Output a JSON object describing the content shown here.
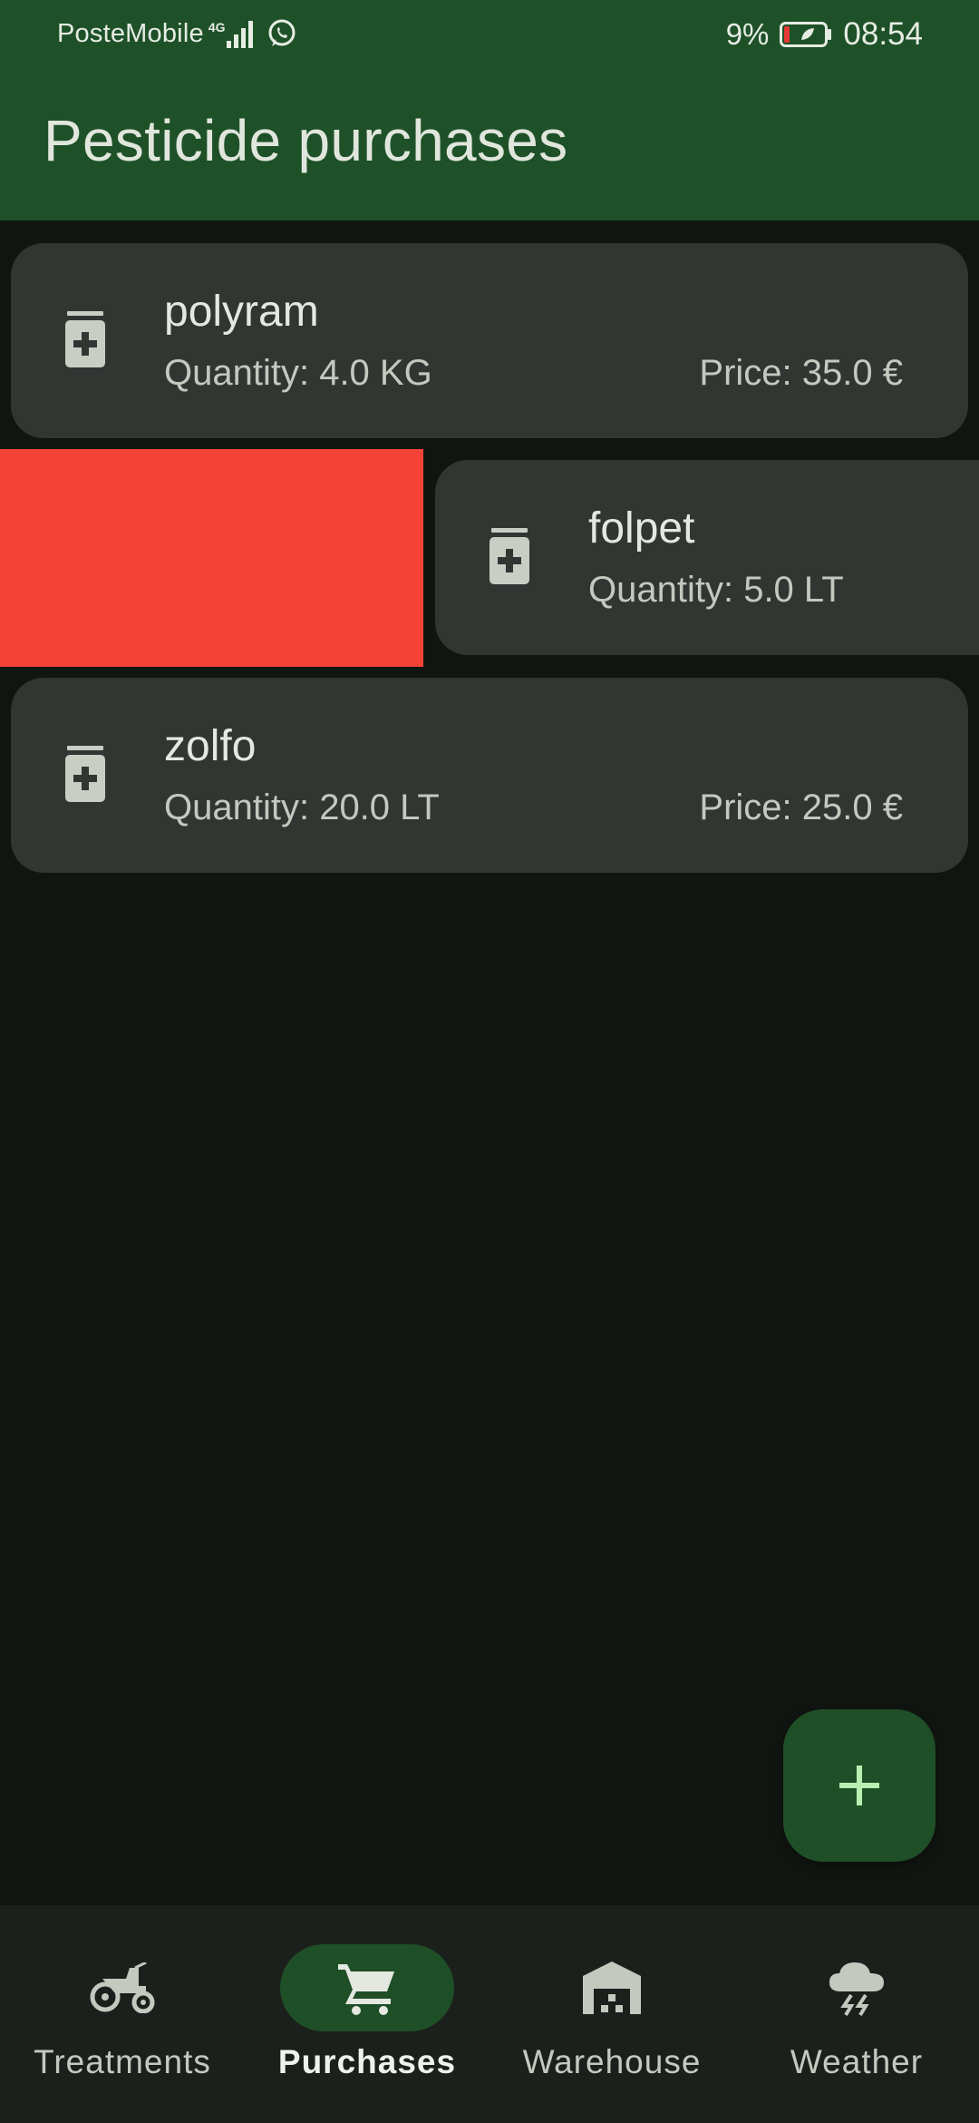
{
  "status_bar": {
    "carrier": "PosteMobile",
    "network": "4G",
    "battery_percent": "9%",
    "time": "08:54"
  },
  "app_bar": {
    "title": "Pesticide purchases"
  },
  "purchases": [
    {
      "name": "polyram",
      "quantity": "Quantity: 4.0 KG",
      "price": "Price: 35.0 €"
    },
    {
      "name": "folpet",
      "quantity": "Quantity: 5.0 LT",
      "price": ""
    },
    {
      "name": "zolfo",
      "quantity": "Quantity: 20.0 LT",
      "price": "Price: 25.0 €"
    }
  ],
  "fab": {
    "icon": "add-icon"
  },
  "bottom_nav": {
    "items": [
      {
        "label": "Treatments",
        "icon": "tractor-icon",
        "active": false
      },
      {
        "label": "Purchases",
        "icon": "cart-icon",
        "active": true
      },
      {
        "label": "Warehouse",
        "icon": "warehouse-icon",
        "active": false
      },
      {
        "label": "Weather",
        "icon": "storm-cloud-icon",
        "active": false
      }
    ]
  },
  "colors": {
    "app_bar": "#1e5128",
    "background": "#111511",
    "card": "#323532",
    "swipe_delete": "#f44336",
    "fab": "#1f4f27",
    "nav_active_indicator": "#1f4f27"
  }
}
